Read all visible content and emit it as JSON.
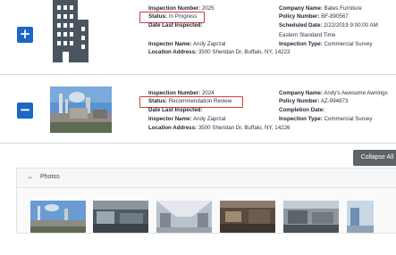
{
  "records": [
    {
      "toggle_symbol": "+",
      "image": "building-icon",
      "inspection_number_label": "Inspection Number:",
      "inspection_number": "2025",
      "status_label": "Status:",
      "status": "In Progress",
      "date_last_inspected_label": "Date Last Inspected:",
      "date_last_inspected": "",
      "inspector_name_label": "Inspector Name:",
      "inspector_name": "Andy Zaprzal",
      "location_address_label": "Location Address:",
      "location_address": "3500 Sheridan Dr, Buffalo, NY, 14223",
      "company_name_label": "Company Name:",
      "company_name": "Bates Furniture",
      "policy_number_label": "Policy Number:",
      "policy_number": "BF-890567",
      "scheduled_date_label": "Scheduled Date:",
      "scheduled_date": "2/22/2019 9:00:00 AM",
      "timezone": "Eastern Standard Time",
      "inspection_type_label": "Inspection Type:",
      "inspection_type": "Commercial Survey"
    },
    {
      "toggle_symbol": "−",
      "image": "factory-photo",
      "inspection_number_label": "Inspection Number:",
      "inspection_number": "2024",
      "status_label": "Status:",
      "status": "Recommendation Review",
      "date_last_inspected_label": "Date Last Inspected:",
      "date_last_inspected": "",
      "inspector_name_label": "Inspector Name:",
      "inspector_name": "Andy Zaprzal",
      "location_address_label": "Location Address:",
      "location_address": "3500 Sheridan Dr, Buffalo, NY, 14226",
      "company_name_label": "Company Name:",
      "company_name": "Andy's Awesome Awnings",
      "policy_number_label": "Policy Number:",
      "policy_number": "AZ-994873",
      "completion_date_label": "Completion Date:",
      "completion_date": "",
      "inspection_type_label": "Inspection Type:",
      "inspection_type": "Commercial Survey"
    }
  ],
  "collapse_all_label": "Collapse All",
  "photos": {
    "toggle_symbol": "−",
    "title": "Photos",
    "thumbnails": [
      "factory-exterior-photo",
      "warehouse-interior-photo",
      "warehouse-shelves-photo",
      "factory-floor-photo",
      "machinery-photo",
      "partial-photo"
    ]
  },
  "colors": {
    "accent_blue": "#1d66c6",
    "status_highlight": "#d23b3b",
    "collapse_button": "#5f6367"
  }
}
